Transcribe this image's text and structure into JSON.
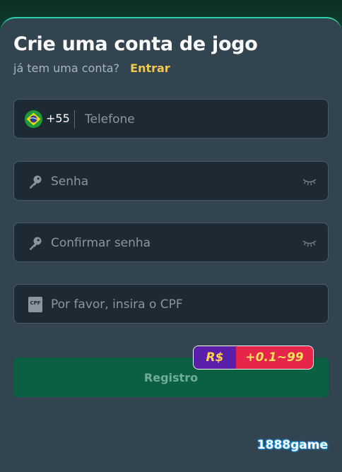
{
  "header": {
    "title": "Crie uma conta de jogo",
    "subtitle": "já tem uma conta?",
    "login_link": "Entrar"
  },
  "form": {
    "phone": {
      "country_code": "+55",
      "placeholder": "Telefone",
      "value": "",
      "flag_icon": "brazil-flag-icon"
    },
    "password": {
      "placeholder": "Senha",
      "value": "",
      "icon": "key-icon",
      "toggle_icon": "eye-closed-icon"
    },
    "confirm_password": {
      "placeholder": "Confirmar senha",
      "value": "",
      "icon": "key-icon",
      "toggle_icon": "eye-closed-icon"
    },
    "cpf": {
      "placeholder": "Por favor, insira o CPF",
      "value": "",
      "icon": "cpf-card-icon",
      "icon_label": "CPF"
    },
    "submit_label": "Registro"
  },
  "promo_badge": {
    "currency": "R$",
    "amount": "+0.1~99"
  },
  "brand": "1888game",
  "colors": {
    "accent": "#2bd3a5",
    "link": "#f2c94c",
    "panel": "#334451",
    "field": "#1d2933",
    "submit": "#0b6044",
    "promo_left": "#5a1fa8",
    "promo_right": "#e5264a"
  }
}
